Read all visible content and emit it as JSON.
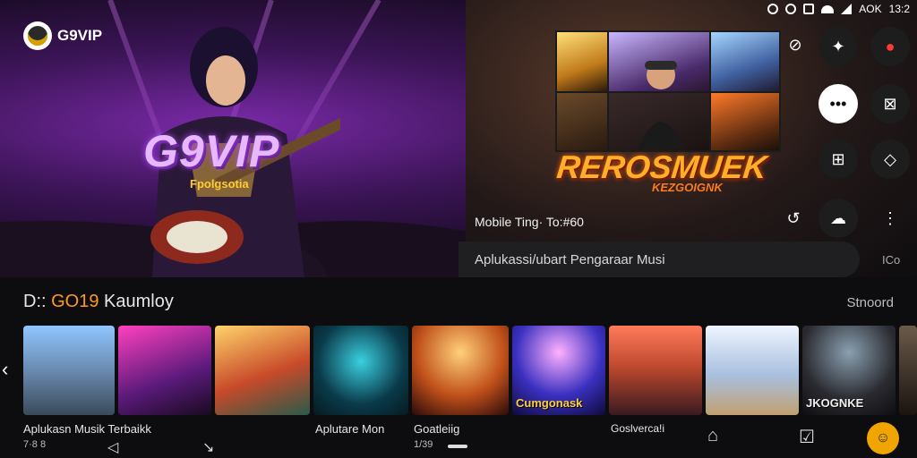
{
  "status_bar": {
    "text": "AOK",
    "time": "13:2"
  },
  "app": {
    "logo_text": "G9VIP"
  },
  "hero": {
    "brand_big": "G9VIP",
    "brand_sub": "Fpolgsotia",
    "rock_title": "REROSMUEK",
    "rock_subtitle": "KEZGOIGNK",
    "mobile_line": "Mobile  Ting·  To:#60"
  },
  "search": {
    "placeholder": "Aplukassi/ubart Pengaraar Musi",
    "right_label": "ICo"
  },
  "section": {
    "title_prefix": "D:: ",
    "title_accent": "GO19",
    "title_rest": " Kaumloy",
    "link": "Stnoord"
  },
  "cards": [
    {
      "title": "",
      "caption": "Aplukasn Musik Terbaikk",
      "sub": "7·8 8"
    },
    {
      "title": "",
      "caption": "",
      "sub": ""
    },
    {
      "title": "",
      "caption": "",
      "sub": ""
    },
    {
      "title": "",
      "caption": "Aplutare Mon",
      "sub": ""
    },
    {
      "title": "",
      "caption": "Goatleiig",
      "sub": "1/39"
    },
    {
      "title": "Cumgonask",
      "caption": "",
      "sub": ""
    },
    {
      "title": "",
      "caption": "Goslverca!i",
      "sub": ""
    },
    {
      "title": "",
      "caption": "",
      "sub": ""
    },
    {
      "title": "JKOGNKE",
      "caption": "",
      "sub": ""
    }
  ],
  "icons": {
    "status": [
      "alarm-icon",
      "record-icon",
      "vibrate-icon",
      "wifi-icon",
      "signal-icon"
    ],
    "side": [
      "compass-icon",
      "person-icon",
      "share-icon",
      "chat-icon",
      "close-box-icon",
      "chip-icon",
      "tag-icon",
      "refresh-icon",
      "cloud-icon",
      "more-icon"
    ],
    "nav": [
      "back-icon",
      "down-icon",
      "home-icon",
      "checkbox-icon",
      "profile-icon"
    ]
  },
  "colors": {
    "accent": "#ff9a1f",
    "fab": "#f0a500",
    "brand_glow": "#b24bff"
  }
}
